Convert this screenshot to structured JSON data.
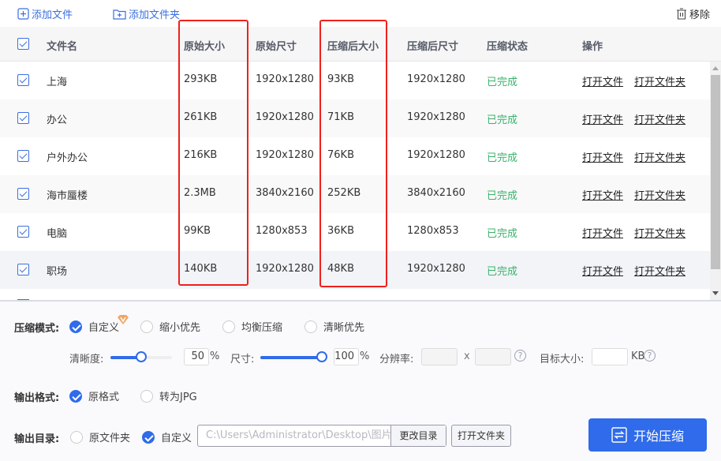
{
  "toolbar": {
    "add_file": "添加文件",
    "add_folder": "添加文件夹",
    "remove": "移除",
    "icons": {
      "add_file": "file-plus-icon",
      "add_folder": "folder-plus-icon",
      "remove": "trash-icon"
    }
  },
  "table": {
    "headers": [
      "文件名",
      "原始大小",
      "原始尺寸",
      "压缩后大小",
      "压缩后尺寸",
      "压缩状态",
      "操作"
    ],
    "all_checked": true,
    "rows": [
      {
        "checked": true,
        "name": "上海",
        "orig_size": "293KB",
        "orig_dim": "1920x1280",
        "comp_size": "93KB",
        "comp_dim": "1920x1280",
        "status": "已完成",
        "action_open_file": "打开文件",
        "action_open_folder": "打开文件夹"
      },
      {
        "checked": true,
        "name": "办公",
        "orig_size": "261KB",
        "orig_dim": "1920x1280",
        "comp_size": "71KB",
        "comp_dim": "1920x1280",
        "status": "已完成",
        "action_open_file": "打开文件",
        "action_open_folder": "打开文件夹"
      },
      {
        "checked": true,
        "name": "户外办公",
        "orig_size": "216KB",
        "orig_dim": "1920x1280",
        "comp_size": "76KB",
        "comp_dim": "1920x1280",
        "status": "已完成",
        "action_open_file": "打开文件",
        "action_open_folder": "打开文件夹"
      },
      {
        "checked": true,
        "name": "海市蜃楼",
        "orig_size": "2.3MB",
        "orig_dim": "3840x2160",
        "comp_size": "252KB",
        "comp_dim": "3840x2160",
        "status": "已完成",
        "action_open_file": "打开文件",
        "action_open_folder": "打开文件夹"
      },
      {
        "checked": true,
        "name": "电脑",
        "orig_size": "99KB",
        "orig_dim": "1280x853",
        "comp_size": "36KB",
        "comp_dim": "1280x853",
        "status": "已完成",
        "action_open_file": "打开文件",
        "action_open_folder": "打开文件夹"
      },
      {
        "checked": true,
        "name": "职场",
        "orig_size": "140KB",
        "orig_dim": "1920x1280",
        "comp_size": "48KB",
        "comp_dim": "1920x1280",
        "status": "已完成",
        "action_open_file": "打开文件",
        "action_open_folder": "打开文件夹"
      }
    ]
  },
  "settings": {
    "mode_label": "压缩模式:",
    "modes": [
      {
        "label": "自定义",
        "selected": true,
        "vip": true
      },
      {
        "label": "缩小优先",
        "selected": false
      },
      {
        "label": "均衡压缩",
        "selected": false
      },
      {
        "label": "清晰优先",
        "selected": false
      }
    ],
    "clarity_label": "清晰度:",
    "clarity_value": "50",
    "clarity_percent": 50,
    "size_label": "尺寸:",
    "size_value": "100",
    "size_percent": 100,
    "percent_sign": "%",
    "resolution_label": "分辨率:",
    "resolution_x": "",
    "resolution_sep": "x",
    "resolution_y": "",
    "target_size_label": "目标大小:",
    "target_size_value": "",
    "target_size_unit": "KB",
    "help_glyph": "?",
    "format_label": "输出格式:",
    "formats": [
      {
        "label": "原格式",
        "selected": true
      },
      {
        "label": "转为JPG",
        "selected": false
      }
    ],
    "output_dir_label": "输出目录:",
    "output_dirs": [
      {
        "label": "原文件夹",
        "selected": false
      },
      {
        "label": "自定义",
        "selected": true
      }
    ],
    "output_path": "C:\\Users\\Administrator\\Desktop\\图片",
    "change_dir": "更改目录",
    "open_folder": "打开文件夹",
    "start": "开始压缩"
  },
  "colors": {
    "accent": "#2f6bea",
    "status_done": "#3bb26b",
    "annotation": "#f0201c"
  }
}
